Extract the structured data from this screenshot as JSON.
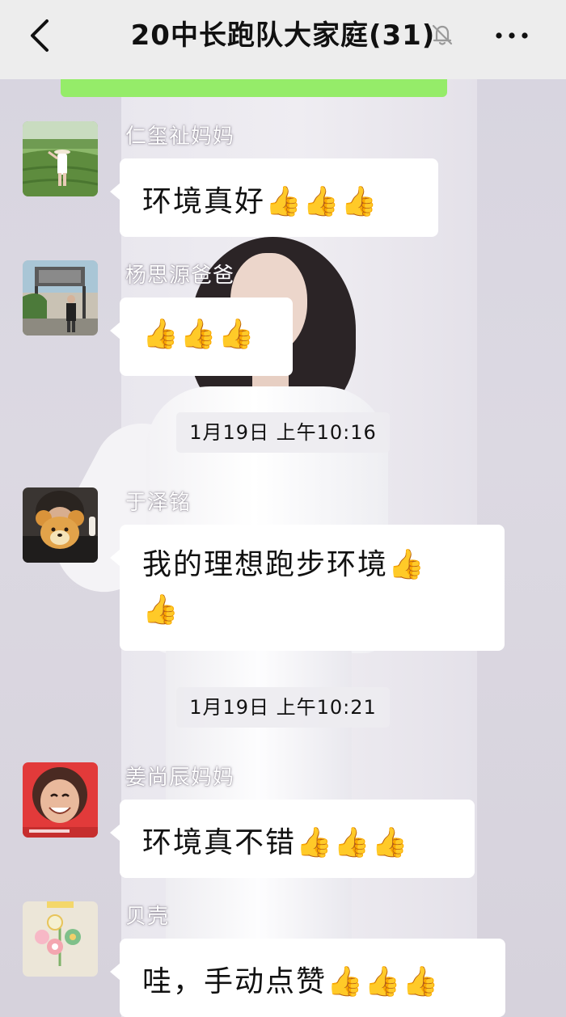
{
  "header": {
    "title": "20中长跑队大家庭(31)",
    "back_icon": "chevron-left-icon",
    "mute_icon": "bell-muted-icon",
    "more_icon": "more-horizontal-icon"
  },
  "colors": {
    "header_bg": "#ededed",
    "bubble_bg": "#ffffff",
    "self_bubble_green": "#95ec69",
    "text": "#111111"
  },
  "messages": [
    {
      "sender": "仁玺祉妈妈",
      "lines": [
        "环境真好👍👍👍"
      ]
    },
    {
      "sender": "杨思源爸爸",
      "lines": [
        "👍👍👍"
      ]
    },
    {
      "sender": "于泽铭",
      "lines": [
        "我的理想跑步环境👍",
        "👍"
      ]
    },
    {
      "sender": "姜尚辰妈妈",
      "lines": [
        "环境真不错👍👍👍"
      ]
    },
    {
      "sender": "贝壳",
      "lines": [
        "哇，手动点赞👍👍👍"
      ]
    }
  ],
  "timestamps": [
    "1月19日 上午10:16",
    "1月19日 上午10:21"
  ]
}
